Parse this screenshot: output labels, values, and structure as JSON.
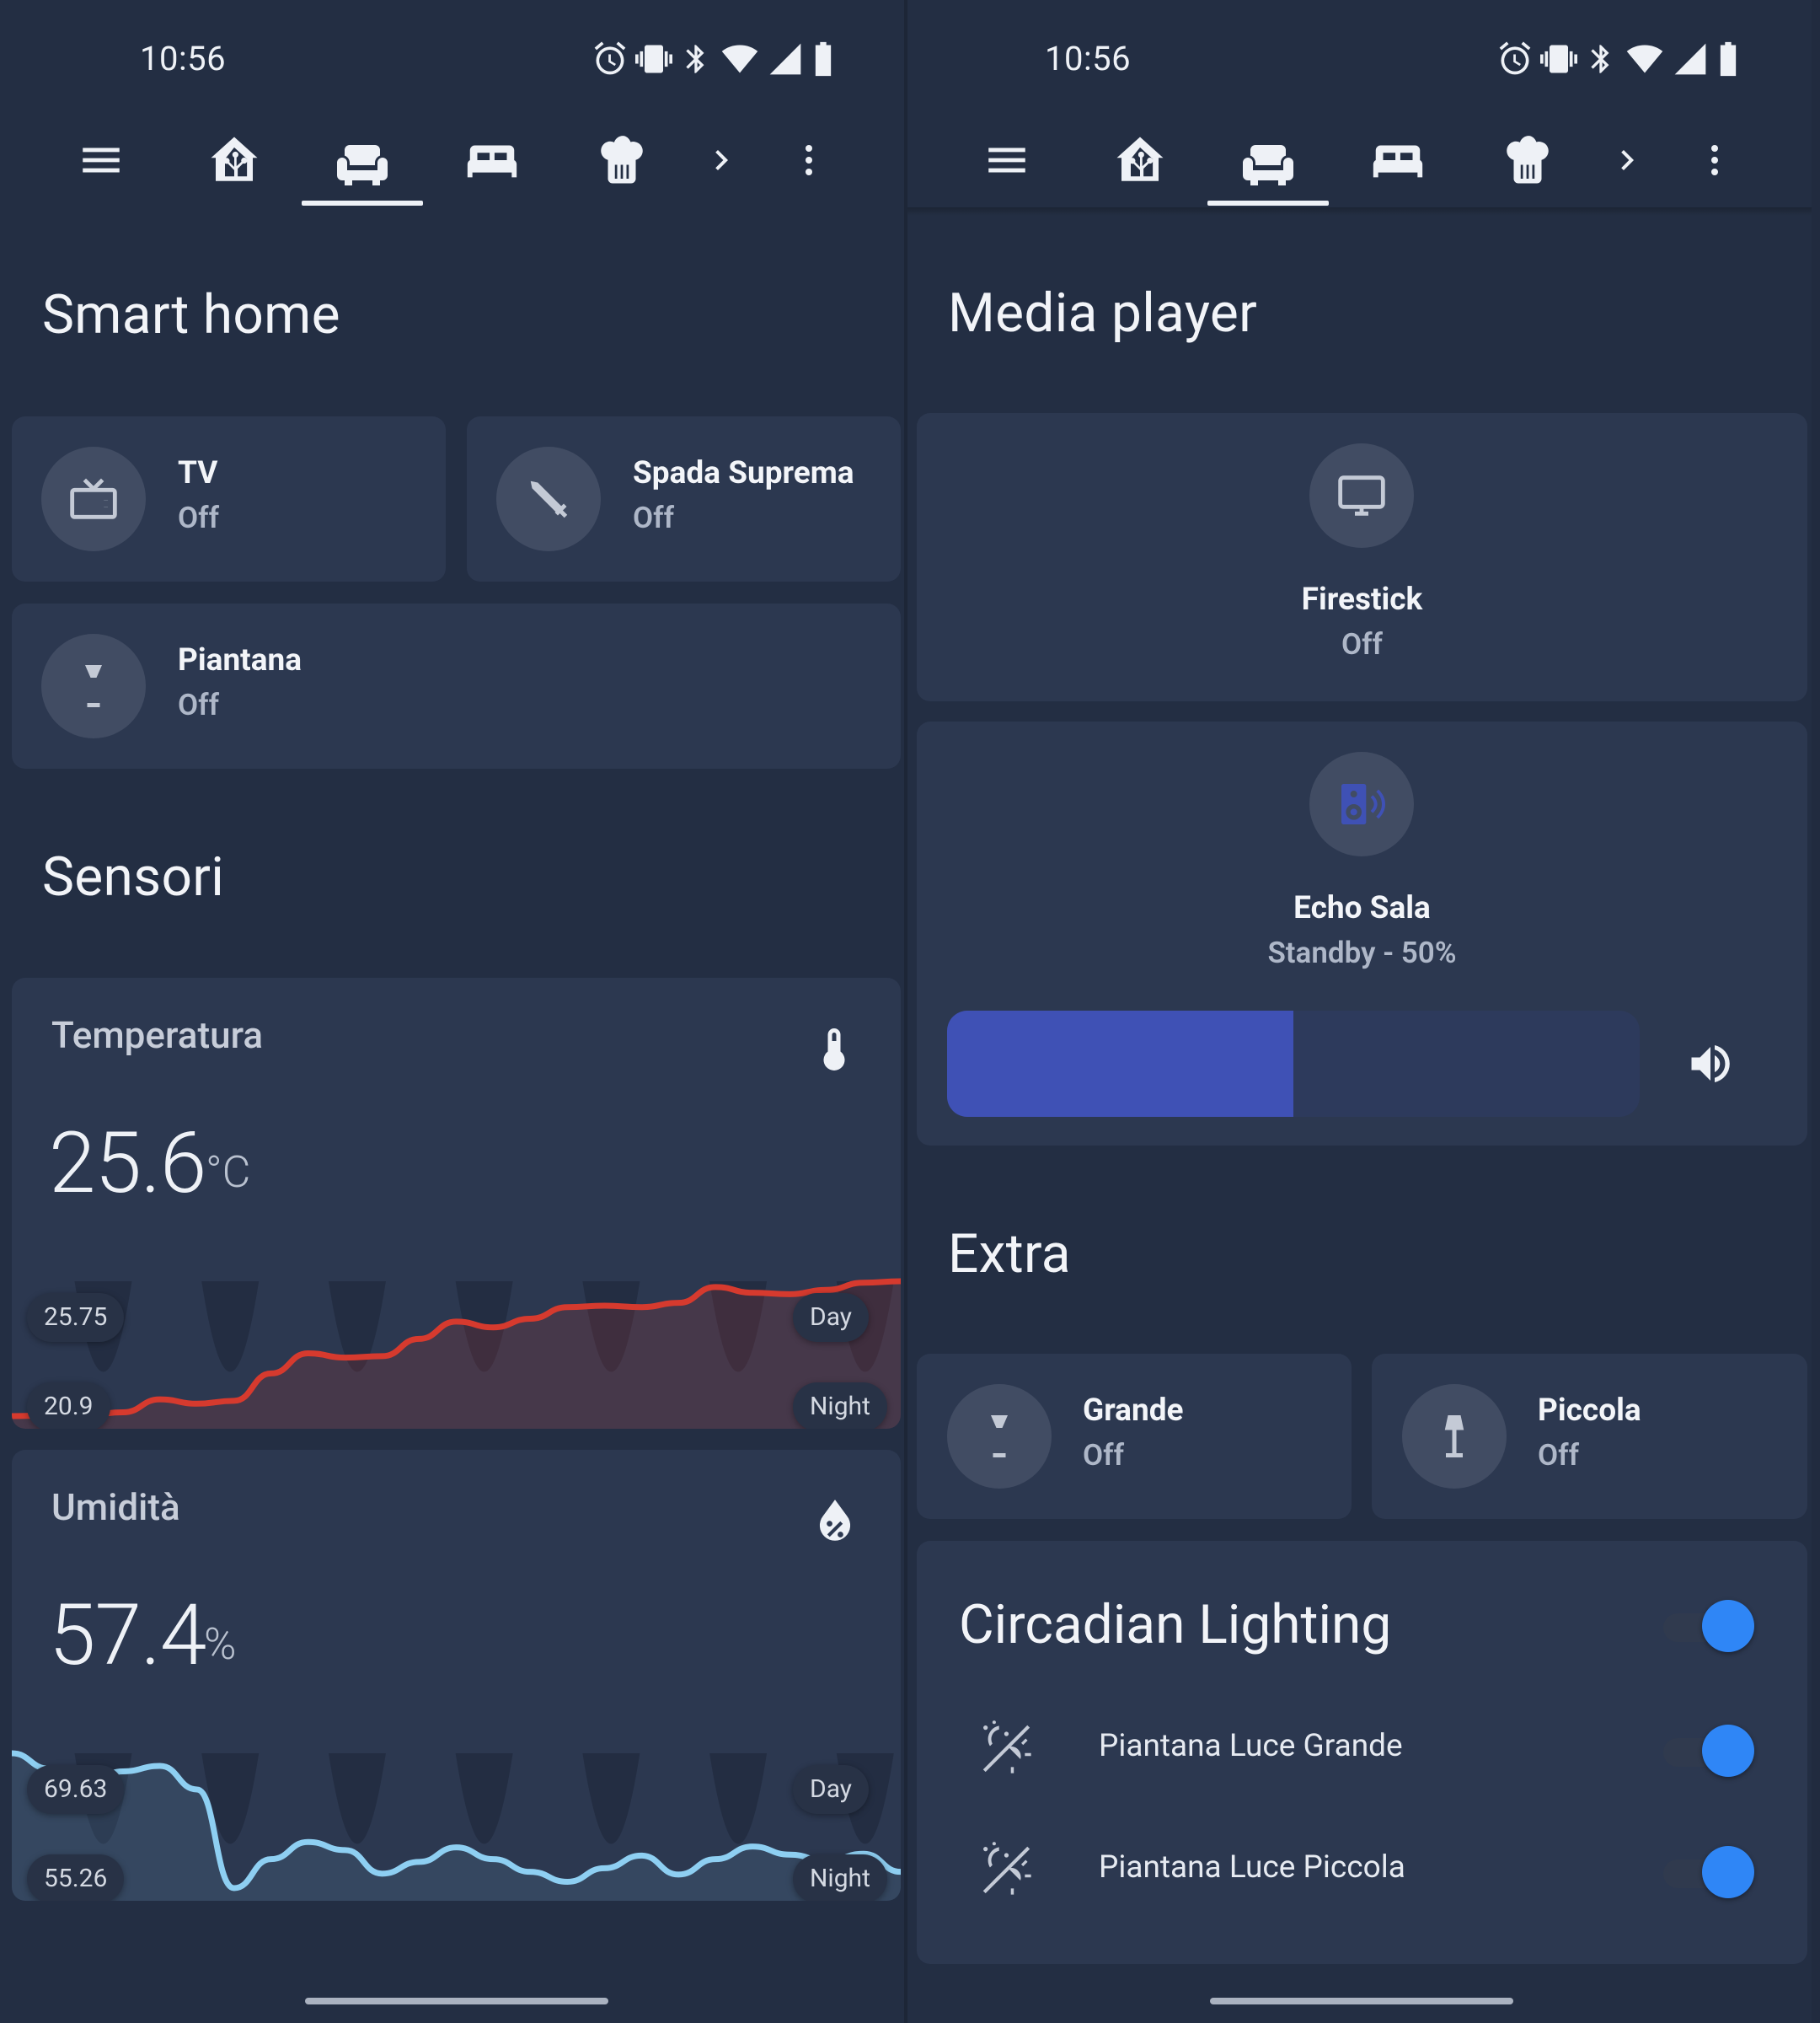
{
  "colors": {
    "background": "#232e43",
    "card": "#2c3850",
    "icon_circle": "#414c63",
    "accent_blue": "#2f86f6",
    "temp_line": "#d63a2e",
    "humidity_line": "#8ecff2",
    "volume_fill": "#3f51b5",
    "speaker_icon": "#3f51b5"
  },
  "status_bar": {
    "time": "10:56",
    "icons": [
      "alarm-icon",
      "vibrate-icon",
      "bluetooth-icon",
      "wifi-icon",
      "signal-icon",
      "battery-icon"
    ]
  },
  "nav_tabs": [
    "menu-icon",
    "home-assistant-icon",
    "sofa-icon",
    "bed-icon",
    "chef-hat-icon",
    "chevron-right-icon",
    "more-vertical-icon"
  ],
  "left": {
    "smart_home": {
      "title": "Smart home",
      "tiles": [
        {
          "name": "TV",
          "state": "Off",
          "icon": "television-icon"
        },
        {
          "name": "Spada Suprema",
          "state": "Off",
          "icon": "sword-icon"
        },
        {
          "name": "Piantana",
          "state": "Off",
          "icon": "floor-lamp-icon"
        }
      ]
    },
    "sensori": {
      "title": "Sensori",
      "temperature": {
        "name": "Temperatura",
        "value": "25.6",
        "unit": "°C",
        "icon": "thermometer-icon",
        "max_label": "25.75",
        "min_label": "20.9",
        "day_label": "Day",
        "night_label": "Night",
        "history": [
          20.92,
          20.94,
          20.96,
          21.05,
          21.5,
          21.35,
          21.45,
          22.4,
          23.1,
          22.95,
          23.0,
          23.6,
          24.2,
          24.0,
          24.3,
          24.7,
          24.75,
          24.7,
          24.85,
          25.4,
          25.2,
          25.15,
          25.3,
          25.55,
          25.6
        ]
      },
      "humidity": {
        "name": "Umidità",
        "value": "57.4",
        "unit": "%",
        "icon": "water-percent-icon",
        "max_label": "69.63",
        "min_label": "55.26",
        "day_label": "Day",
        "night_label": "Night",
        "history": [
          70.5,
          68.8,
          67.2,
          68.5,
          69.1,
          66.5,
          55.6,
          58.8,
          60.7,
          59.8,
          57.2,
          58.5,
          60.1,
          58.8,
          57.4,
          56.3,
          57.8,
          59.2,
          57.1,
          58.8,
          60.2,
          59.3,
          58.6,
          59.4,
          57.4
        ]
      }
    }
  },
  "right": {
    "media_player": {
      "title": "Media player",
      "firestick": {
        "name": "Firestick",
        "state": "Off",
        "icon": "monitor-icon"
      },
      "echo": {
        "name": "Echo Sala",
        "state": "Standby - 50%",
        "icon": "speaker-wireless-icon",
        "volume_fraction": 0.5,
        "volume_icon": "volume-high-icon"
      }
    },
    "extra": {
      "title": "Extra",
      "tiles": [
        {
          "name": "Grande",
          "state": "Off",
          "icon": "floor-lamp-icon"
        },
        {
          "name": "Piccola",
          "state": "Off",
          "icon": "lamp-icon"
        }
      ]
    },
    "circadian": {
      "title": "Circadian Lighting",
      "enabled": true,
      "rows": [
        {
          "label": "Piantana Luce Grande",
          "icon": "sun-moon-stars-icon",
          "enabled": true
        },
        {
          "label": "Piantana Luce Piccola",
          "icon": "sun-moon-stars-icon",
          "enabled": true
        }
      ]
    }
  }
}
